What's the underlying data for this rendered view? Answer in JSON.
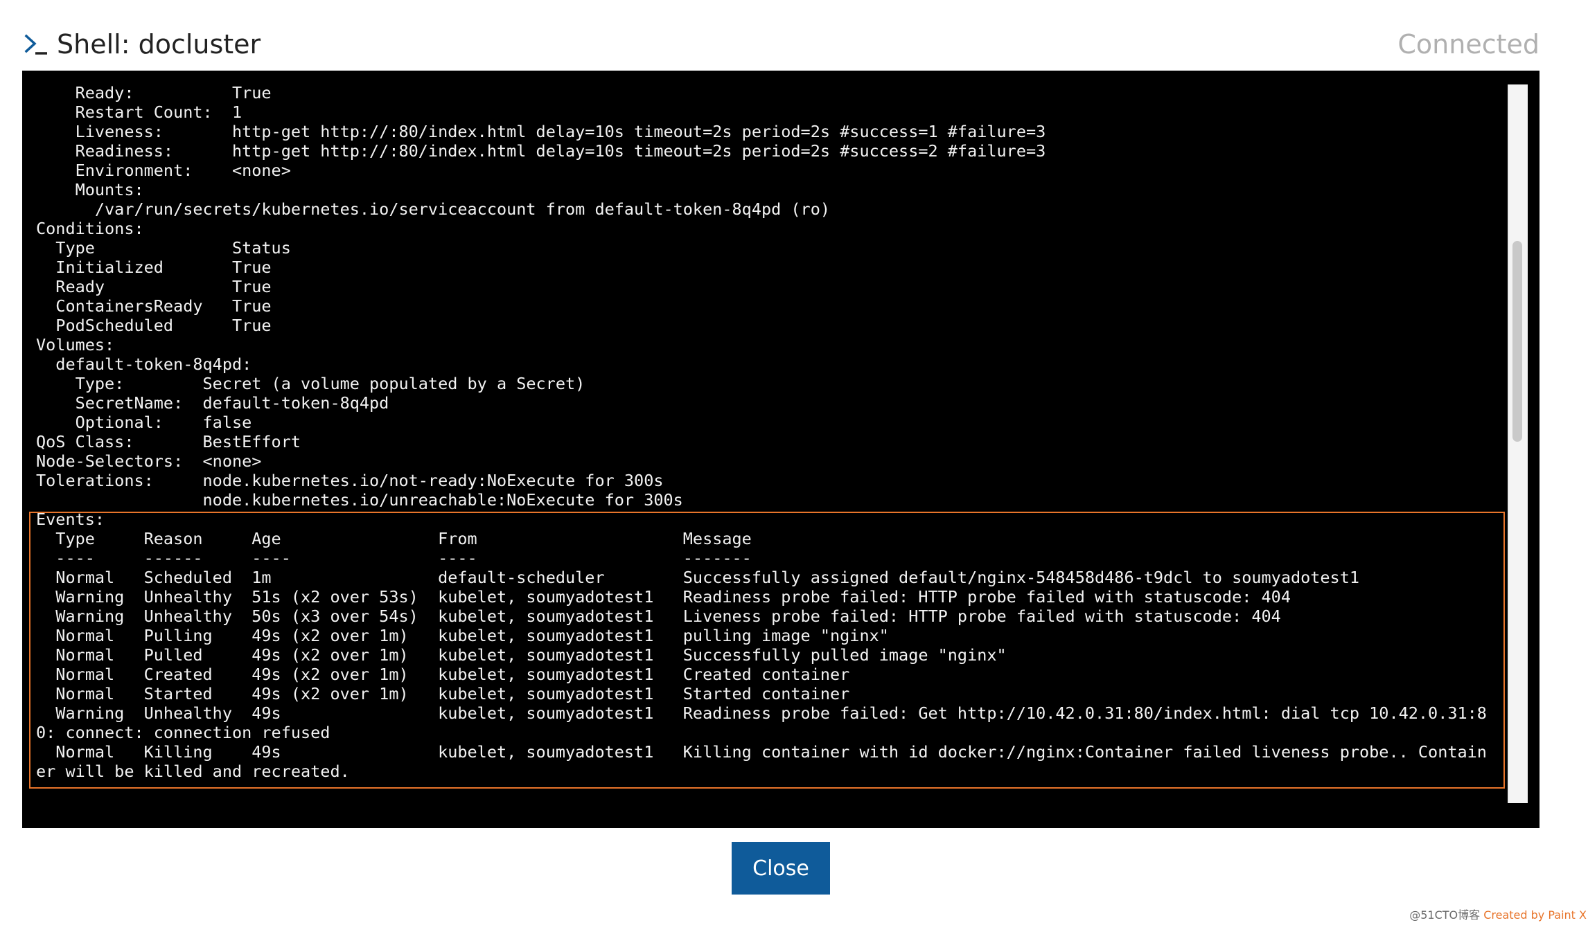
{
  "header": {
    "icon": "terminal-prompt-icon",
    "title": "Shell: docluster",
    "status": "Connected"
  },
  "terminal": {
    "lines": [
      "    Ready:          True",
      "    Restart Count:  1",
      "    Liveness:       http-get http://:80/index.html delay=10s timeout=2s period=2s #success=1 #failure=3",
      "    Readiness:      http-get http://:80/index.html delay=10s timeout=2s period=2s #success=2 #failure=3",
      "    Environment:    <none>",
      "    Mounts:",
      "      /var/run/secrets/kubernetes.io/serviceaccount from default-token-8q4pd (ro)",
      "Conditions:",
      "  Type              Status",
      "  Initialized       True",
      "  Ready             True",
      "  ContainersReady   True",
      "  PodScheduled      True",
      "Volumes:",
      "  default-token-8q4pd:",
      "    Type:        Secret (a volume populated by a Secret)",
      "    SecretName:  default-token-8q4pd",
      "    Optional:    false",
      "QoS Class:       BestEffort",
      "Node-Selectors:  <none>",
      "Tolerations:     node.kubernetes.io/not-ready:NoExecute for 300s",
      "                 node.kubernetes.io/unreachable:NoExecute for 300s",
      "Events:",
      "  Type     Reason     Age                From                     Message",
      "  ----     ------     ----               ----                     -------",
      "  Normal   Scheduled  1m                 default-scheduler        Successfully assigned default/nginx-548458d486-t9dcl to soumyadotest1",
      "  Warning  Unhealthy  51s (x2 over 53s)  kubelet, soumyadotest1   Readiness probe failed: HTTP probe failed with statuscode: 404",
      "  Warning  Unhealthy  50s (x3 over 54s)  kubelet, soumyadotest1   Liveness probe failed: HTTP probe failed with statuscode: 404",
      "  Normal   Pulling    49s (x2 over 1m)   kubelet, soumyadotest1   pulling image \"nginx\"",
      "  Normal   Pulled     49s (x2 over 1m)   kubelet, soumyadotest1   Successfully pulled image \"nginx\"",
      "  Normal   Created    49s (x2 over 1m)   kubelet, soumyadotest1   Created container",
      "  Normal   Started    49s (x2 over 1m)   kubelet, soumyadotest1   Started container",
      "  Warning  Unhealthy  49s                kubelet, soumyadotest1   Readiness probe failed: Get http://10.42.0.31:80/index.html: dial tcp 10.42.0.31:8",
      "0: connect: connection refused",
      "  Normal   Killing    49s                kubelet, soumyadotest1   Killing container with id docker://nginx:Container failed liveness probe.. Contain",
      "er will be killed and recreated."
    ]
  },
  "footer": {
    "close_label": "Close"
  },
  "watermark": {
    "text": "@51CTO博客",
    "sub": "Created by Paint X"
  },
  "colors": {
    "terminal_bg": "#000000",
    "terminal_text": "#f2f2f2",
    "highlight_border": "#e8742a",
    "button_bg": "#0f5b9a",
    "status_text": "#b0b0b0"
  }
}
